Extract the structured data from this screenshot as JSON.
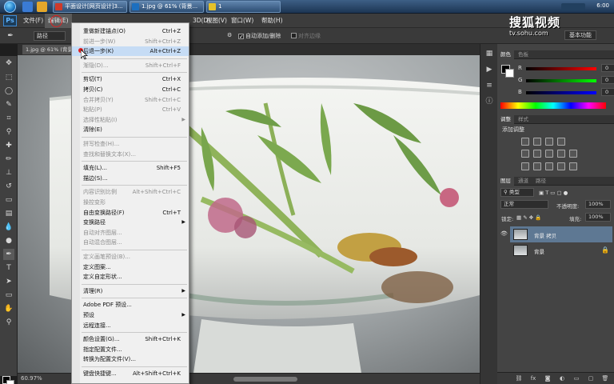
{
  "taskbar": {
    "tasks": [
      {
        "label": "平面设计[网页设计]3..."
      },
      {
        "label": "1.jpg @ 61% (背景..."
      },
      {
        "label": "1"
      }
    ],
    "clock": "6:00"
  },
  "app": {
    "logo": "Ps",
    "menus": [
      "文件(F)",
      "编辑(E)",
      "图像(I)",
      "图层(L)",
      "类型(Y)",
      "选择(S)",
      "滤镜(T)",
      "3D(D)",
      "视图(V)",
      "窗口(W)",
      "帮助(H)"
    ],
    "active_menu_index": 1
  },
  "watermark": {
    "title": "搜狐视频",
    "url": "tv.sohu.com"
  },
  "options": {
    "mode": "路径",
    "auto_add_delete": "自动添加/删除",
    "align_edges": "对齐边缘",
    "workspace": "基本功能"
  },
  "document": {
    "tab": "1.jpg @ 61% (背景...",
    "zoom": "60.97%"
  },
  "edit_menu": {
    "items": [
      {
        "label": "重做新建锚点(O)",
        "shortcut": "Ctrl+Z",
        "disabled": false
      },
      {
        "label": "前进一步(W)",
        "shortcut": "Shift+Ctrl+Z",
        "disabled": true
      },
      {
        "label": "后退一步(K)",
        "shortcut": "Alt+Ctrl+Z",
        "disabled": false,
        "hover": true
      },
      {
        "sep": true
      },
      {
        "label": "渐隐(D)...",
        "shortcut": "Shift+Ctrl+F",
        "disabled": true
      },
      {
        "sep": true
      },
      {
        "label": "剪切(T)",
        "shortcut": "Ctrl+X",
        "disabled": false
      },
      {
        "label": "拷贝(C)",
        "shortcut": "Ctrl+C",
        "disabled": false
      },
      {
        "label": "合并拷贝(Y)",
        "shortcut": "Shift+Ctrl+C",
        "disabled": true
      },
      {
        "label": "粘贴(P)",
        "shortcut": "Ctrl+V",
        "disabled": true
      },
      {
        "label": "选择性粘贴(I)",
        "shortcut": "",
        "disabled": true,
        "submenu": true
      },
      {
        "label": "清除(E)",
        "shortcut": "",
        "disabled": false
      },
      {
        "sep": true
      },
      {
        "label": "拼写检查(H)...",
        "shortcut": "",
        "disabled": true
      },
      {
        "label": "查找和替换文本(X)...",
        "shortcut": "",
        "disabled": true
      },
      {
        "sep": true
      },
      {
        "label": "填充(L)...",
        "shortcut": "Shift+F5",
        "disabled": false
      },
      {
        "label": "描边(S)...",
        "shortcut": "",
        "disabled": false
      },
      {
        "sep": true
      },
      {
        "label": "内容识别比例",
        "shortcut": "Alt+Shift+Ctrl+C",
        "disabled": true
      },
      {
        "label": "操控变形",
        "shortcut": "",
        "disabled": true
      },
      {
        "label": "自由变换路径(F)",
        "shortcut": "Ctrl+T",
        "disabled": false
      },
      {
        "label": "变换路径",
        "shortcut": "",
        "disabled": false,
        "submenu": true
      },
      {
        "label": "自动对齐图层...",
        "shortcut": "",
        "disabled": true
      },
      {
        "label": "自动混合图层...",
        "shortcut": "",
        "disabled": true
      },
      {
        "sep": true
      },
      {
        "label": "定义画笔预设(B)...",
        "shortcut": "",
        "disabled": true
      },
      {
        "label": "定义图案...",
        "shortcut": "",
        "disabled": false
      },
      {
        "label": "定义自定形状...",
        "shortcut": "",
        "disabled": false
      },
      {
        "sep": true
      },
      {
        "label": "清理(R)",
        "shortcut": "",
        "disabled": false,
        "submenu": true
      },
      {
        "sep": true
      },
      {
        "label": "Adobe PDF 预设...",
        "shortcut": "",
        "disabled": false
      },
      {
        "label": "预设",
        "shortcut": "",
        "disabled": false,
        "submenu": true
      },
      {
        "label": "远程连接...",
        "shortcut": "",
        "disabled": false
      },
      {
        "sep": true
      },
      {
        "label": "颜色设置(G)...",
        "shortcut": "Shift+Ctrl+K",
        "disabled": false
      },
      {
        "label": "指定配置文件...",
        "shortcut": "",
        "disabled": false
      },
      {
        "label": "转换为配置文件(V)...",
        "shortcut": "",
        "disabled": false
      },
      {
        "sep": true
      },
      {
        "label": "键盘快捷键...",
        "shortcut": "Alt+Shift+Ctrl+K",
        "disabled": false
      }
    ]
  },
  "color_panel": {
    "tabs": [
      "颜色",
      "色板"
    ],
    "channels": [
      {
        "name": "R",
        "value": "0"
      },
      {
        "name": "G",
        "value": "0"
      },
      {
        "name": "B",
        "value": "0"
      }
    ]
  },
  "adjust_panel": {
    "tabs": [
      "调整",
      "样式"
    ],
    "title": "添加调整"
  },
  "layers_panel": {
    "tabs": [
      "图层",
      "通道",
      "路径"
    ],
    "filter": "类型",
    "blend_mode": "正常",
    "opacity_label": "不透明度:",
    "opacity": "100%",
    "lock_label": "锁定:",
    "fill_label": "填充:",
    "fill": "100%",
    "layers": [
      {
        "name": "背景 拷贝",
        "selected": true
      },
      {
        "name": "背景",
        "selected": false
      }
    ]
  }
}
